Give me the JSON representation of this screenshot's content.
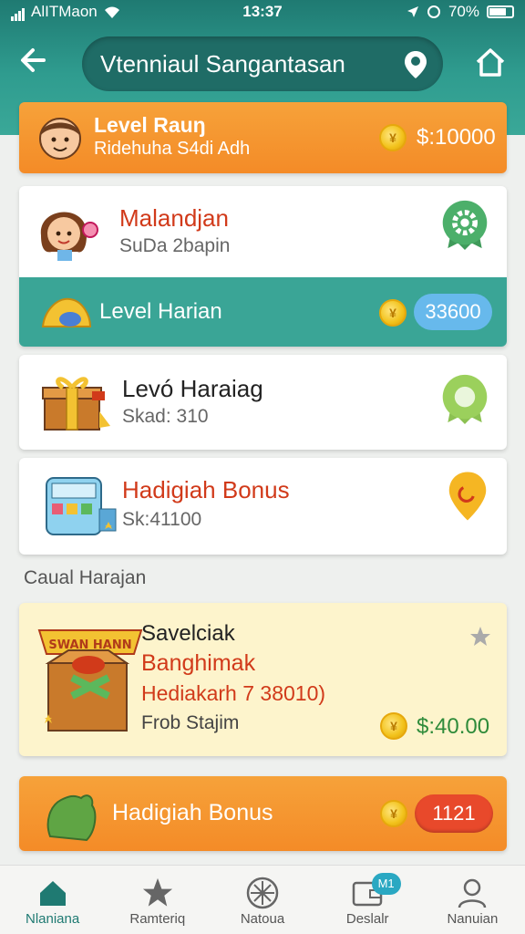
{
  "status_bar": {
    "carrier": "AlITMaon",
    "time": "13:37",
    "battery": "70%"
  },
  "header": {
    "title": "Vtenniaul Sangantasan"
  },
  "cards": {
    "level": {
      "title": "Level Rauŋ",
      "subtitle": "Ridehuha S4di Adh",
      "amount": "$:10000"
    },
    "profile": {
      "title": "Malandjan",
      "subtitle": "SuDa 2bapin"
    },
    "level_harian": {
      "title": "Level Harian",
      "amount": "33600"
    },
    "levo": {
      "title": "Levó Haraiag",
      "subtitle": "Skad: 310"
    },
    "hadigiah": {
      "title": "Hadigiah Bonus",
      "subtitle": "Sk:41100"
    },
    "casual": {
      "sign": "SWAN HANN",
      "line1": "Savelciak",
      "line2": "Banghimak",
      "line3": "Hediakarh 7 38010)",
      "line4": "Frob Stajim",
      "amount": "$:40.00"
    },
    "bonus_bottom": {
      "title": "Hadigiah Bonus",
      "amount": "1121"
    }
  },
  "section_label": "Caual Harajan",
  "nav": {
    "items": [
      {
        "label": "Nlaniana"
      },
      {
        "label": "Ramteriq"
      },
      {
        "label": "Natoua"
      },
      {
        "label": "Deslalr",
        "badge": "M1"
      },
      {
        "label": "Nanuian"
      }
    ]
  },
  "colors": {
    "teal": "#2f9c8f",
    "orange": "#f48b27",
    "cream": "#fdf4cc",
    "red_text": "#d13a1a"
  }
}
